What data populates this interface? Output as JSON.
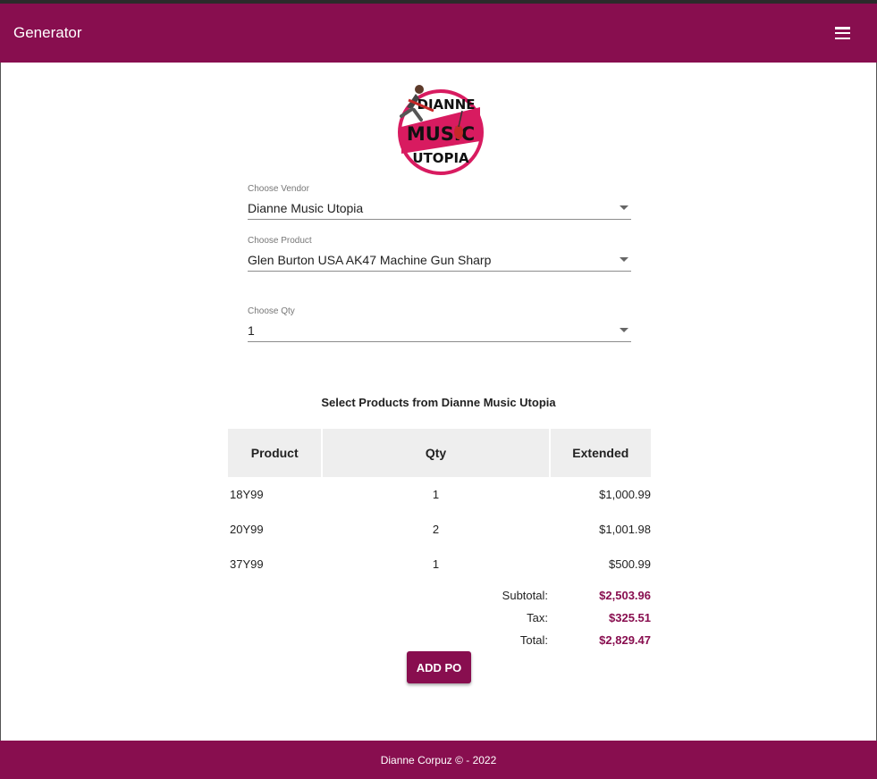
{
  "header": {
    "title": "Generator",
    "menu_icon": "hamburger-menu-icon"
  },
  "logo": {
    "line1": "DIANNE",
    "line2": "MUSIC",
    "line3": "UTOPIA",
    "brand_color": "#d81b60"
  },
  "form": {
    "vendor": {
      "label": "Choose Vendor",
      "value": "Dianne Music Utopia"
    },
    "product": {
      "label": "Choose Product",
      "value": "Glen Burton USA AK47 Machine Gun Sharp"
    },
    "qty": {
      "label": "Choose Qty",
      "value": "1"
    }
  },
  "section_title": "Select Products from Dianne Music Utopia",
  "table": {
    "headers": {
      "product": "Product",
      "qty": "Qty",
      "extended": "Extended"
    },
    "rows": [
      {
        "product": "18Y99",
        "qty": "1",
        "extended": "$1,000.99"
      },
      {
        "product": "20Y99",
        "qty": "2",
        "extended": "$1,001.98"
      },
      {
        "product": "37Y99",
        "qty": "1",
        "extended": "$500.99"
      }
    ]
  },
  "totals": {
    "subtotal_label": "Subtotal:",
    "subtotal": "$2,503.96",
    "tax_label": "Tax:",
    "tax": "$325.51",
    "total_label": "Total:",
    "total": "$2,829.47"
  },
  "add_button": "ADD PO",
  "footer": "Dianne Corpuz © - 2022",
  "colors": {
    "primary": "#880e4f",
    "header_bg": "#eeeeee"
  }
}
